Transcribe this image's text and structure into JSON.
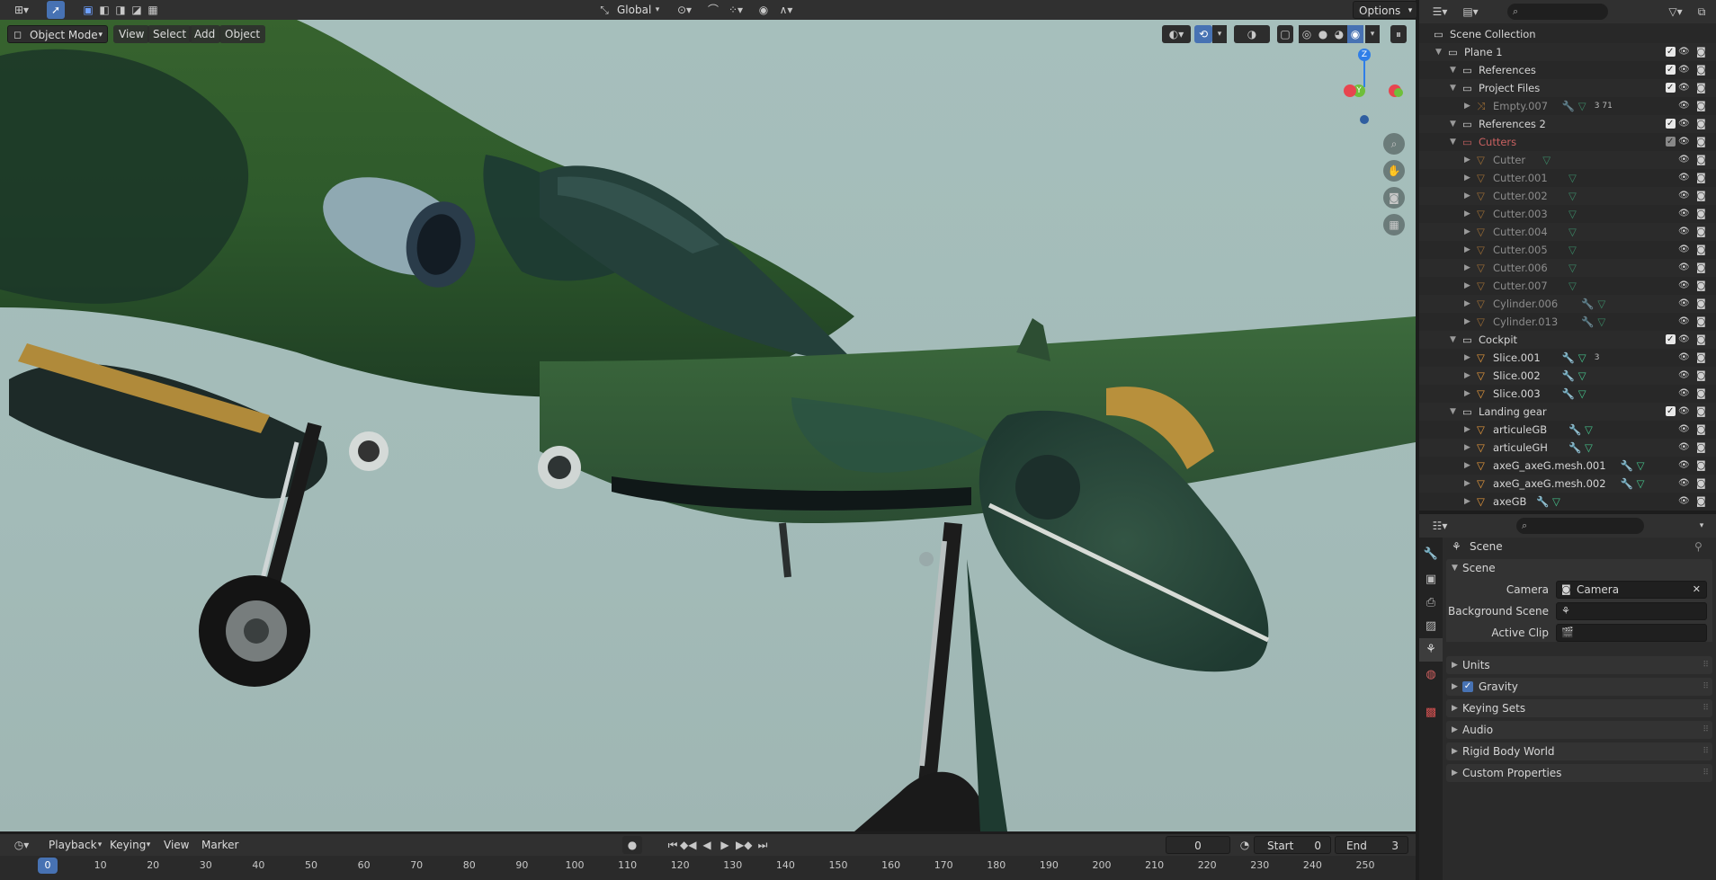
{
  "top_header": {
    "transform_orientation": "Global",
    "options_label": "Options"
  },
  "viewport_header": {
    "mode": "Object Mode",
    "menus": [
      "View",
      "Select",
      "Add",
      "Object"
    ]
  },
  "gizmo": {
    "axis_z": "Z",
    "axis_y": "Y"
  },
  "outliner": {
    "rows": [
      {
        "label": "Scene Collection",
        "indent": 0,
        "type": "scene",
        "dim": false
      },
      {
        "label": "Plane 1",
        "indent": 1,
        "type": "collection",
        "dim": false
      },
      {
        "label": "References",
        "indent": 2,
        "type": "collection",
        "dim": false
      },
      {
        "label": "Project Files",
        "indent": 2,
        "type": "collection",
        "dim": false
      },
      {
        "label": "Empty.007",
        "indent": 3,
        "type": "empty",
        "dim": true,
        "extra": "3  71"
      },
      {
        "label": "References 2",
        "indent": 2,
        "type": "collection",
        "dim": false
      },
      {
        "label": "Cutters",
        "indent": 2,
        "type": "collection",
        "dim": true,
        "red": true
      },
      {
        "label": "Cutter",
        "indent": 3,
        "type": "mesh",
        "dim": true
      },
      {
        "label": "Cutter.001",
        "indent": 3,
        "type": "mesh",
        "dim": true
      },
      {
        "label": "Cutter.002",
        "indent": 3,
        "type": "mesh",
        "dim": true
      },
      {
        "label": "Cutter.003",
        "indent": 3,
        "type": "mesh",
        "dim": true
      },
      {
        "label": "Cutter.004",
        "indent": 3,
        "type": "mesh",
        "dim": true
      },
      {
        "label": "Cutter.005",
        "indent": 3,
        "type": "mesh",
        "dim": true
      },
      {
        "label": "Cutter.006",
        "indent": 3,
        "type": "mesh",
        "dim": true
      },
      {
        "label": "Cutter.007",
        "indent": 3,
        "type": "mesh",
        "dim": true
      },
      {
        "label": "Cylinder.006",
        "indent": 3,
        "type": "mesh",
        "dim": true
      },
      {
        "label": "Cylinder.013",
        "indent": 3,
        "type": "mesh",
        "dim": true
      },
      {
        "label": "Cockpit",
        "indent": 2,
        "type": "collection",
        "dim": false
      },
      {
        "label": "Slice.001",
        "indent": 3,
        "type": "mesh",
        "dim": false,
        "extra": "3"
      },
      {
        "label": "Slice.002",
        "indent": 3,
        "type": "mesh",
        "dim": false
      },
      {
        "label": "Slice.003",
        "indent": 3,
        "type": "mesh",
        "dim": false
      },
      {
        "label": "Landing gear",
        "indent": 2,
        "type": "collection",
        "dim": false
      },
      {
        "label": "articuleGB",
        "indent": 3,
        "type": "mesh",
        "dim": false
      },
      {
        "label": "articuleGH",
        "indent": 3,
        "type": "mesh",
        "dim": false
      },
      {
        "label": "axeG_axeG.mesh.001",
        "indent": 3,
        "type": "mesh",
        "dim": false
      },
      {
        "label": "axeG_axeG.mesh.002",
        "indent": 3,
        "type": "mesh",
        "dim": false
      },
      {
        "label": "axeGB",
        "indent": 3,
        "type": "mesh",
        "dim": false
      }
    ]
  },
  "properties": {
    "breadcrumb": "Scene",
    "panel_title": "Scene",
    "fields": [
      {
        "label": "Camera",
        "value": "Camera"
      },
      {
        "label": "Background Scene",
        "value": ""
      },
      {
        "label": "Active Clip",
        "value": ""
      }
    ],
    "gravity_label": "Gravity",
    "collapsed_panels": [
      "Units",
      "Gravity",
      "Keying Sets",
      "Audio",
      "Rigid Body World",
      "Custom Properties"
    ]
  },
  "timeline": {
    "menus": [
      "Playback",
      "Keying",
      "View",
      "Marker"
    ],
    "current_frame": "0",
    "start_label": "Start",
    "start_value": "0",
    "end_label": "End",
    "end_value": "3",
    "ticks": [
      "0",
      "10",
      "20",
      "30",
      "40",
      "50",
      "60",
      "70",
      "80",
      "90",
      "100",
      "110",
      "120",
      "130",
      "140",
      "150",
      "160",
      "170",
      "180",
      "190",
      "200",
      "210",
      "220",
      "230",
      "240",
      "250"
    ]
  },
  "colors": {
    "accent_blue": "#4772b3",
    "mesh_orange": "#e89a3c",
    "modifier_blue": "#6b9be0",
    "data_green": "#45c08a"
  }
}
